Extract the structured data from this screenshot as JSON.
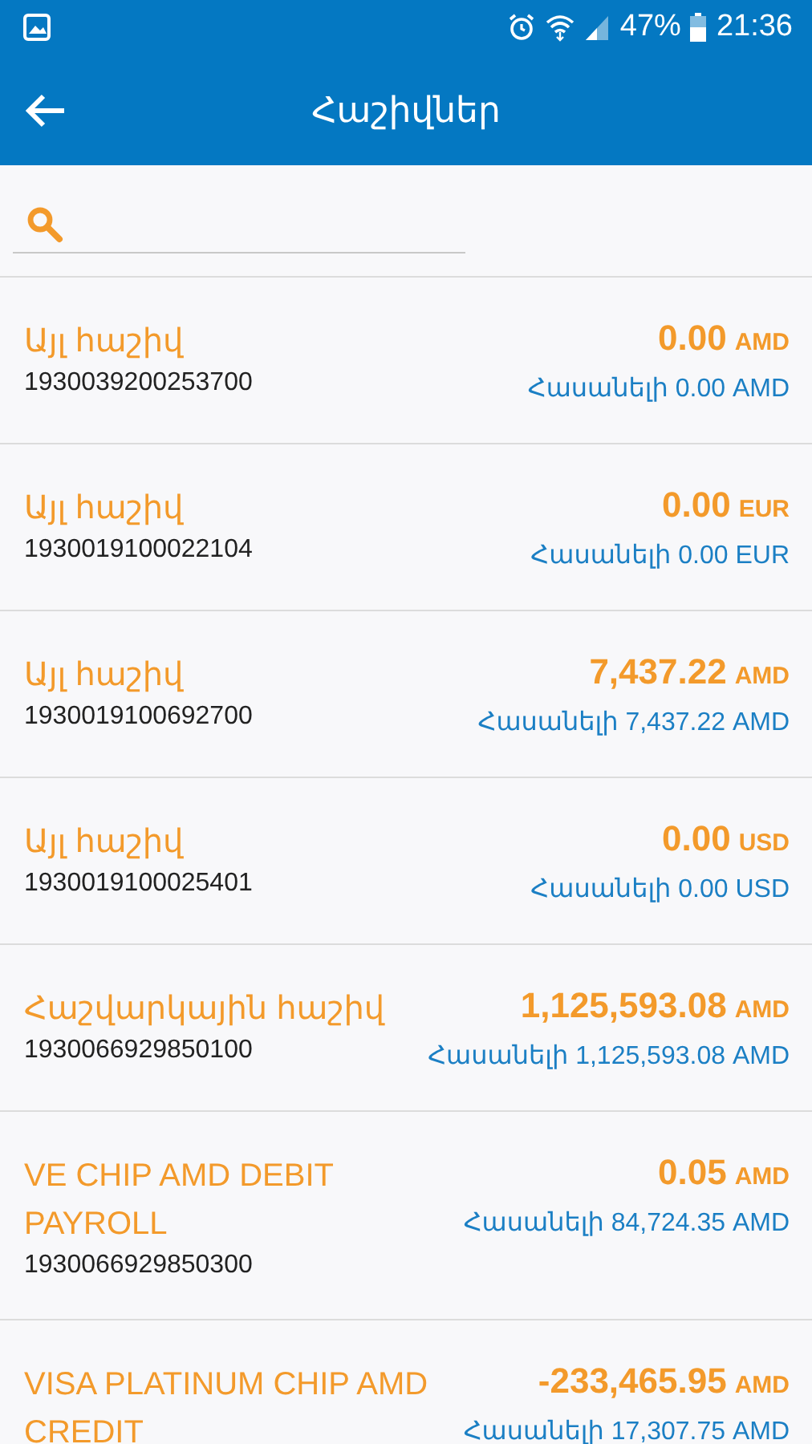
{
  "status_bar": {
    "battery": "47%",
    "time": "21:36"
  },
  "app_bar": {
    "title": "Հաշիվներ"
  },
  "accounts": [
    {
      "name": "Այլ հաշիվ",
      "number": "1930039200253700",
      "amount": "0.00",
      "currency": "AMD",
      "available": "Հասանելի 0.00 AMD"
    },
    {
      "name": "Այլ հաշիվ",
      "number": "1930019100022104",
      "amount": "0.00",
      "currency": "EUR",
      "available": "Հասանելի 0.00 EUR"
    },
    {
      "name": "Այլ հաշիվ",
      "number": "1930019100692700",
      "amount": "7,437.22",
      "currency": "AMD",
      "available": "Հասանելի 7,437.22 AMD"
    },
    {
      "name": "Այլ հաշիվ",
      "number": "1930019100025401",
      "amount": "0.00",
      "currency": "USD",
      "available": "Հասանելի 0.00 USD"
    },
    {
      "name": "Հաշվարկային հաշիվ",
      "number": "1930066929850100",
      "amount": "1,125,593.08",
      "currency": "AMD",
      "available": "Հասանելի 1,125,593.08 AMD"
    },
    {
      "name": "VE CHIP AMD DEBIT PAYROLL",
      "number": "1930066929850300",
      "amount": "0.05",
      "currency": "AMD",
      "available": "Հասանելի 84,724.35 AMD"
    },
    {
      "name": "VISA PLATINUM CHIP AMD CREDIT",
      "amount": "-233,465.95",
      "currency": "AMD",
      "available": "Հասանելի 17,307.75 AMD"
    }
  ]
}
